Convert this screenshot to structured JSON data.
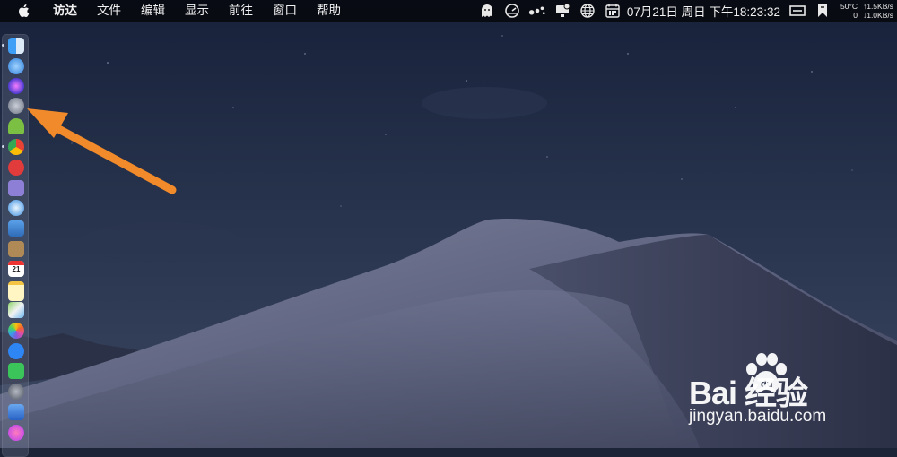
{
  "menubar": {
    "app_name": "访达",
    "items": [
      "文件",
      "编辑",
      "显示",
      "前往",
      "窗口",
      "帮助"
    ],
    "clock": "07月21日 周日 下午18:23:32",
    "stats": {
      "temperature": "50°C",
      "fan": "0",
      "upload": "↑1.5KB/s",
      "download": "↓1.0KB/s"
    },
    "status_icons": [
      "ghost-icon",
      "gauge-icon",
      "dots-icon",
      "display-icon",
      "globe-icon",
      "calendar-icon",
      "screen-icon",
      "bookmark-icon"
    ]
  },
  "dock": {
    "icons": [
      "finder-icon",
      "app-store-icon",
      "siri-icon",
      "launchpad-icon",
      "android-icon",
      "chrome-icon",
      "red-app-icon",
      "calculator-icon",
      "safari-icon",
      "preview-icon",
      "notes-icon",
      "calendar-icon",
      "notes-yellow-icon",
      "maps-icon",
      "photos-icon",
      "messages-icon",
      "wechat-icon",
      "system-preferences-icon",
      "keynote-icon",
      "itunes-icon"
    ],
    "calendar_day": "21"
  },
  "watermark": {
    "logo": "Bai  经验",
    "url": "jingyan.baidu.com"
  },
  "colors": {
    "arrow": "#f08a2a",
    "sky": "#1c2538",
    "dune": "#6a6f87"
  }
}
